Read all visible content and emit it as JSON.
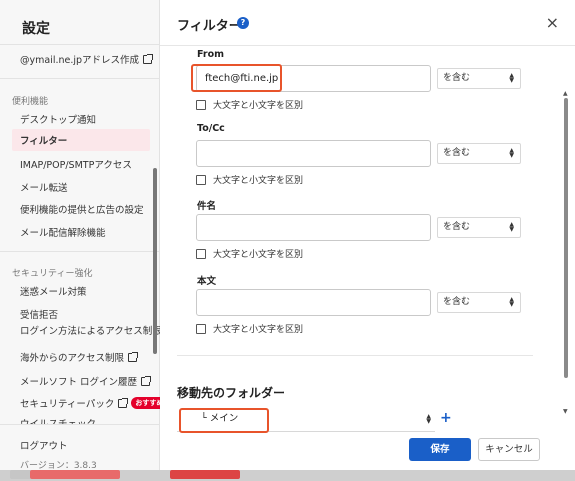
{
  "sidebar": {
    "title": "設定",
    "items_top": [
      {
        "label": "@ymail.ne.jpアドレス作成",
        "external": true
      }
    ],
    "section_convenience": "便利機能",
    "convenience_items": [
      {
        "label": "デスクトップ通知"
      },
      {
        "label": "フィルター",
        "selected": true
      },
      {
        "label": "IMAP/POP/SMTPアクセス"
      },
      {
        "label": "メール転送"
      },
      {
        "label": "便利機能の提供と広告の設定"
      },
      {
        "label": "メール配信解除機能"
      }
    ],
    "section_security": "セキュリティー強化",
    "security_items": [
      {
        "label": "迷惑メール対策"
      },
      {
        "label": "受信拒否"
      },
      {
        "label": "ログイン方法によるアクセス制限"
      },
      {
        "label": "海外からのアクセス制限"
      },
      {
        "label": "メールソフト ログイン履歴"
      },
      {
        "label": "セキュリティーパック",
        "badge": "おすすめ"
      },
      {
        "label": "ウイルスチェック"
      }
    ],
    "logout": "ログアウト",
    "version": "バージョン：3.8.3"
  },
  "dialog": {
    "title": "フィルター",
    "help_icon": "?",
    "close_icon": "×"
  },
  "filters": {
    "from": {
      "label": "From",
      "value": "ftech@fti.ne.jp",
      "operator": "を含む",
      "case_label": "大文字と小文字を区別"
    },
    "tocc": {
      "label": "To/Cc",
      "value": "",
      "operator": "を含む",
      "case_label": "大文字と小文字を区別"
    },
    "subject": {
      "label": "件名",
      "value": "",
      "operator": "を含む",
      "case_label": "大文字と小文字を区別"
    },
    "body": {
      "label": "本文",
      "value": "",
      "operator": "を含む",
      "case_label": "大文字と小文字を区別"
    }
  },
  "destination": {
    "title": "移動先のフォルダー",
    "folder": "└ メイン",
    "add_icon": "+"
  },
  "buttons": {
    "save": "保存",
    "cancel": "キャンセル"
  },
  "colors": {
    "accent": "#1a5fc8",
    "highlight": "#e8542b",
    "selected_bg": "#fbe7ea",
    "badge": "#e4002b"
  }
}
